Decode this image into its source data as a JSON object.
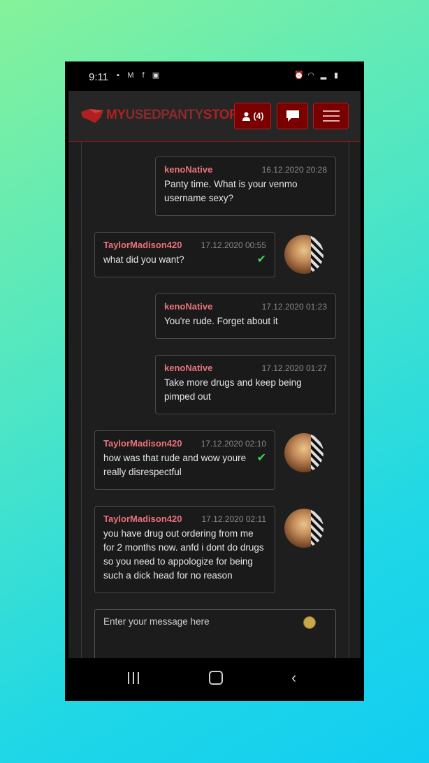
{
  "status_bar": {
    "time": "9:11"
  },
  "brand": {
    "part1": "MY",
    "part2": "USEDPANTY",
    "part3": "STORE"
  },
  "nav": {
    "users_count": "(4)"
  },
  "messages": [
    {
      "user": "kenoNative",
      "time": "16.12.2020 20:28",
      "text": "Panty time. What is your venmo username sexy?",
      "side": "right",
      "read": false
    },
    {
      "user": "TaylorMadison420",
      "time": "17.12.2020 00:55",
      "text": "what did you want?",
      "side": "left",
      "read": true
    },
    {
      "user": "kenoNative",
      "time": "17.12.2020 01:23",
      "text": "You're rude. Forget about it",
      "side": "right",
      "read": false
    },
    {
      "user": "kenoNative",
      "time": "17.12.2020 01:27",
      "text": "Take more drugs and keep being pimped out",
      "side": "right",
      "read": false
    },
    {
      "user": "TaylorMadison420",
      "time": "17.12.2020 02:10",
      "text": "how was that rude and wow youre really disrespectful",
      "side": "left",
      "read": true
    },
    {
      "user": "TaylorMadison420",
      "time": "17.12.2020 02:11",
      "text": "you have drug out ordering from me for 2 months now. anfd i dont do drugs so you need to appologize for being such a dick head for no reason",
      "side": "left",
      "read": false
    }
  ],
  "composer": {
    "placeholder": "Enter your message here"
  },
  "colors": {
    "accent": "#7a0000",
    "username": "#e8727a",
    "read_check": "#3cd65a"
  }
}
